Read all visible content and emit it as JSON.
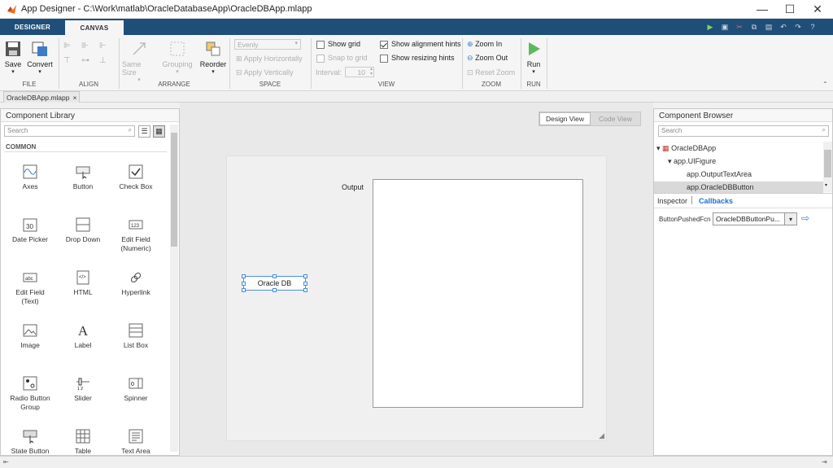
{
  "window": {
    "title": "App Designer - C:\\Work\\matlab\\OracleDatabaseApp\\OracleDBApp.mlapp",
    "minimize": "—",
    "maximize": "☐",
    "close": "✕"
  },
  "tabs": [
    {
      "label": "DESIGNER"
    },
    {
      "label": "CANVAS"
    }
  ],
  "ribbon": {
    "file": {
      "label": "FILE",
      "save": "Save",
      "convert": "Convert"
    },
    "align": {
      "label": "ALIGN"
    },
    "arrange": {
      "label": "ARRANGE",
      "same_size": "Same Size",
      "grouping": "Grouping",
      "reorder": "Reorder"
    },
    "space": {
      "label": "SPACE",
      "evenly": "Evenly",
      "apply_h": "Apply Horizontally",
      "apply_v": "Apply Vertically"
    },
    "view": {
      "label": "VIEW",
      "show_grid": "Show grid",
      "snap_grid": "Snap to grid",
      "interval_label": "Interval:",
      "interval_value": "10",
      "show_align": "Show alignment hints",
      "show_resize": "Show resizing hints"
    },
    "zoom": {
      "label": "ZOOM",
      "zoom_in": "Zoom In",
      "zoom_out": "Zoom Out",
      "reset_zoom": "Reset Zoom"
    },
    "run": {
      "label": "RUN",
      "run": "Run"
    }
  },
  "doc_tab": {
    "label": "OracleDBApp.mlapp",
    "close": "×"
  },
  "component_library": {
    "title": "Component Library",
    "search_placeholder": "Search",
    "section": "COMMON",
    "items": [
      {
        "label": "Axes"
      },
      {
        "label": "Button"
      },
      {
        "label": "Check Box"
      },
      {
        "label": "Date Picker"
      },
      {
        "label": "Drop Down"
      },
      {
        "label": "Edit Field\n(Numeric)"
      },
      {
        "label": "Edit Field\n(Text)"
      },
      {
        "label": "HTML"
      },
      {
        "label": "Hyperlink"
      },
      {
        "label": "Image"
      },
      {
        "label": "Label"
      },
      {
        "label": "List Box"
      },
      {
        "label": "Radio Button\nGroup"
      },
      {
        "label": "Slider"
      },
      {
        "label": "Spinner"
      },
      {
        "label": "State Button"
      },
      {
        "label": "Table"
      },
      {
        "label": "Text Area"
      }
    ]
  },
  "canvas": {
    "design_view": "Design View",
    "code_view": "Code View",
    "output_label": "Output",
    "button_label": "Oracle DB"
  },
  "component_browser": {
    "title": "Component Browser",
    "search_placeholder": "Search",
    "tree": [
      {
        "label": "OracleDBApp"
      },
      {
        "label": "app.UIFigure"
      },
      {
        "label": "app.OutputTextArea"
      },
      {
        "label": "app.OracleDBButton"
      }
    ],
    "inspector_tab": "Inspector",
    "callbacks_tab": "Callbacks",
    "callback_name": "ButtonPushedFcn",
    "callback_value": "OracleDBButtonPu..."
  }
}
